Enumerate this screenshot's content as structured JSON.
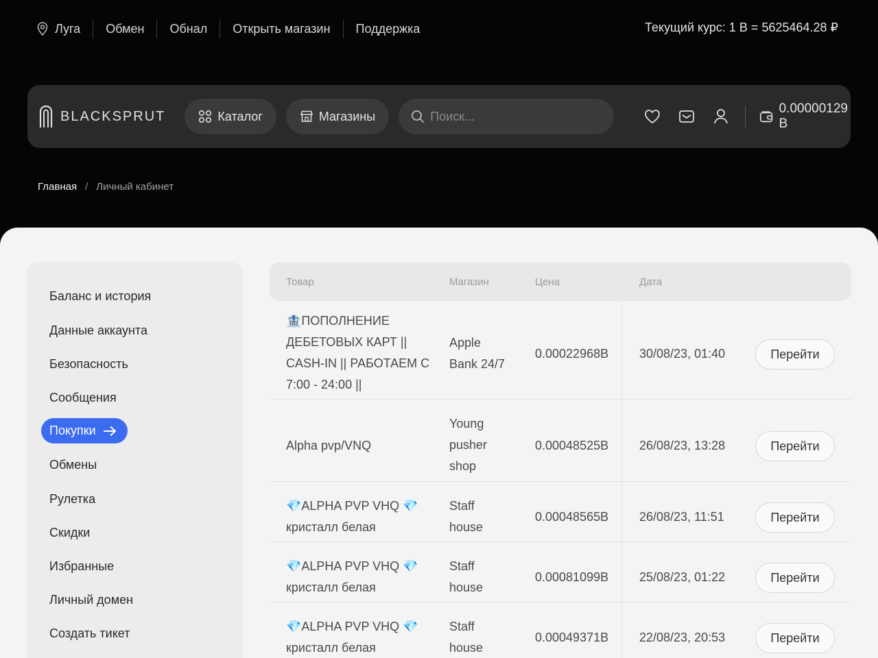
{
  "topbar": {
    "city": "Луга",
    "links": [
      "Обмен",
      "Обнал",
      "Открыть магазин",
      "Поддержка"
    ],
    "rate": "Текущий курс: 1 B = 5625464.28 ₽"
  },
  "navbar": {
    "brand": "BLACKSPRUT",
    "catalog": "Каталог",
    "shops": "Магазины",
    "search_placeholder": "Поиск...",
    "wallet": "0.00000129 B",
    "icons": [
      "heart-icon",
      "mail-icon",
      "user-icon",
      "wallet-icon"
    ]
  },
  "breadcrumb": {
    "home": "Главная",
    "separator": "/",
    "current": "Личный кабинет"
  },
  "sidebar": {
    "items": [
      {
        "label": "Баланс и история"
      },
      {
        "label": "Данные аккаунта"
      },
      {
        "label": "Безопасность"
      },
      {
        "label": "Сообщения"
      },
      {
        "label": "Покупки",
        "active": true
      },
      {
        "label": "Обмены"
      },
      {
        "label": "Рулетка"
      },
      {
        "label": "Скидки"
      },
      {
        "label": "Избранные"
      },
      {
        "label": "Личный домен"
      },
      {
        "label": "Создать тикет"
      }
    ]
  },
  "table": {
    "headers": {
      "product": "Товар",
      "shop": "Магазин",
      "price": "Цена",
      "date": "Дата"
    },
    "go_label": "Перейти",
    "rows": [
      {
        "product": [
          "🏦ПОПОЛНЕНИЕ",
          "ДЕБЕТОВЫХ КАРТ ||",
          "CASH-IN || РАБОТАЕМ С",
          "7:00 - 24:00 ||"
        ],
        "shop": [
          "Apple",
          "Bank 24/7"
        ],
        "price": "0.00022968B",
        "date": "30/08/23, 01:40"
      },
      {
        "product": [
          "Alpha pvp/VNQ"
        ],
        "shop": [
          "Young",
          "pusher",
          "shop"
        ],
        "price": "0.00048525B",
        "date": "26/08/23, 13:28"
      },
      {
        "product": [
          "💎ALPHA PVP VHQ 💎",
          "кристалл белая"
        ],
        "shop": [
          "Staff",
          "house"
        ],
        "price": "0.00048565B",
        "date": "26/08/23, 11:51"
      },
      {
        "product": [
          "💎ALPHA PVP VHQ 💎",
          "кристалл белая"
        ],
        "shop": [
          "Staff",
          "house"
        ],
        "price": "0.00081099B",
        "date": "25/08/23, 01:22"
      },
      {
        "product": [
          "💎ALPHA PVP VHQ 💎",
          "кристалл белая"
        ],
        "shop": [
          "Staff",
          "house"
        ],
        "price": "0.00049371B",
        "date": "22/08/23, 20:53"
      }
    ]
  },
  "colors": {
    "background": "#050505",
    "navbar": "#2a2a2a",
    "panel": "#f4f4f4",
    "accent": "#3b6cf0"
  }
}
